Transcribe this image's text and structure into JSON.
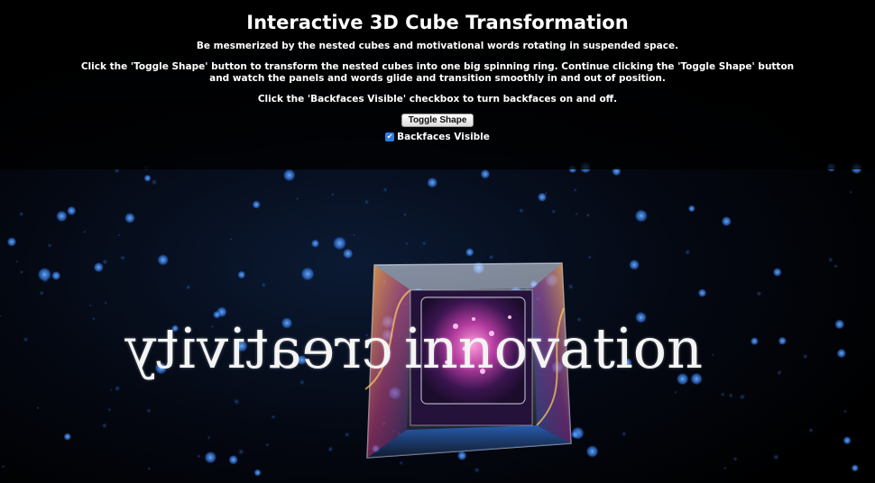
{
  "header": {
    "title": "Interactive 3D Cube Transformation",
    "intro": "Be mesmerized by the nested cubes and motivational words rotating in suspended space.",
    "instructions_toggle": "Click the 'Toggle Shape' button to transform the nested cubes into one big spinning ring. Continue clicking the 'Toggle Shape' button and watch the panels and words glide and transition smoothly in and out of position.",
    "instructions_backfaces": "Click the 'Backfaces Visible' checkbox to turn backfaces on and off.",
    "toggle_button_label": "Toggle Shape",
    "backfaces_checkbox": {
      "label": "Backfaces Visible",
      "checked": true
    }
  },
  "scene": {
    "word_left_mirrored": "creativity",
    "word_right": "innovation",
    "background_color": "#000000",
    "accent_color": "#2f7de1"
  }
}
